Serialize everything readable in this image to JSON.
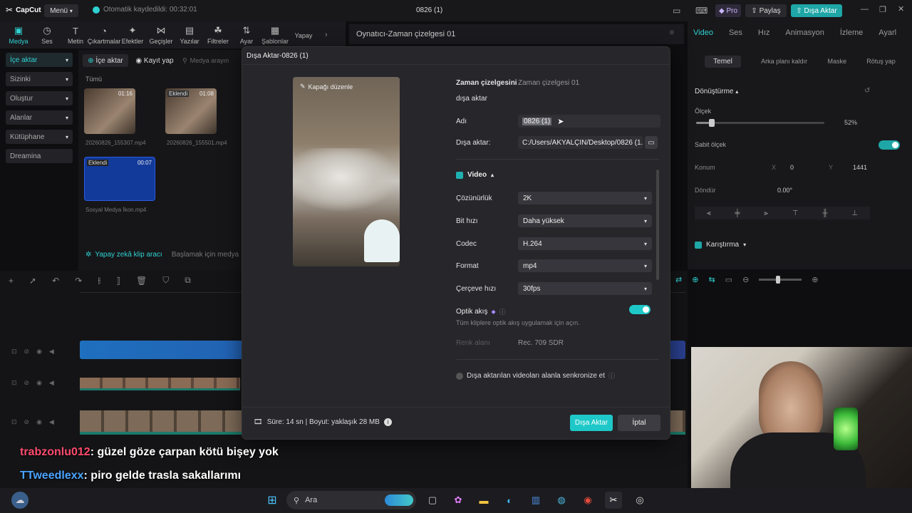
{
  "titlebar": {
    "app": "CapCut",
    "menu": "Menü",
    "autosave": "Otomatik kaydedildi: 00:32:01",
    "project": "0826 (1)",
    "pro": "Pro",
    "share": "Paylaş",
    "export": "Dışa Aktar"
  },
  "toolbar": {
    "items": [
      "Medya",
      "Ses",
      "Metin",
      "Çıkartmalar",
      "Efektler",
      "Geçişler",
      "Yazılar",
      "Filtreler",
      "Ayar",
      "Şablonlar",
      "Yapay"
    ]
  },
  "sidebar": {
    "items": [
      "İçe aktar",
      "Sizinki",
      "Oluştur",
      "Alanlar",
      "Kütüphane",
      "Dreamina"
    ]
  },
  "media": {
    "import": "İçe aktar",
    "record": "Kayıt yap",
    "search_placeholder": "Medya arayın",
    "all": "Tümü",
    "clips": [
      {
        "name": "20260826_155307.mp4",
        "dur": "01:16",
        "badge": ""
      },
      {
        "name": "20260826_155501.mp4",
        "dur": "01:08",
        "badge": "Eklendi"
      },
      {
        "name": "Sosyal Medya İkon.mp4",
        "dur": "00:07",
        "badge": "Eklendi"
      }
    ],
    "ai_clip": "Yapay zekâ klip aracı",
    "ai_hint": "Başlamak için medya"
  },
  "player": {
    "title": "Oynatıcı-Zaman çizelgesi 01"
  },
  "right": {
    "tabs": [
      "Video",
      "Ses",
      "Hız",
      "Animasyon",
      "İzleme",
      "Ayarl"
    ],
    "subtabs": [
      "Temel",
      "Arka planı kaldır",
      "Maske",
      "Rötuş yap"
    ],
    "transform": "Dönüştürme",
    "scale": "Ölçek",
    "scale_val": "52%",
    "scale_level": 0.12,
    "uniform": "Sabit ölçek",
    "position": "Konum",
    "x_label": "X",
    "x_val": "0",
    "y_label": "Y",
    "y_val": "1441",
    "rotate": "Döndür",
    "rotate_val": "0.00°",
    "blend": "Karıştırma"
  },
  "dialog": {
    "title": "Dışa Aktar-0826 (1)",
    "edit_cover": "Kapağı düzenle",
    "timeline_label": "Zaman çizelgesini",
    "timeline_label2": "dışa aktar",
    "timeline_val": "Zaman çizelgesi 01",
    "name_label": "Adı",
    "name_val": "0826 (1)",
    "path_label": "Dışa aktar:",
    "path_val": "C:/Users/AKYALÇIN/Desktop/0826 (1...",
    "video_section": "Video",
    "resolution_label": "Çözünürlük",
    "resolution_val": "2K",
    "bitrate_label": "Bit hızı",
    "bitrate_val": "Daha yüksek",
    "codec_label": "Codec",
    "codec_val": "H.264",
    "format_label": "Format",
    "format_val": "mp4",
    "fps_label": "Çerçeve hızı",
    "fps_val": "30fps",
    "optical_label": "Optik akış",
    "optical_hint": "Tüm kliplere optik akış uygulamak için açın.",
    "color_label": "Renk alanı",
    "color_val": "Rec. 709 SDR",
    "sync_label": "Dışa aktarılan videoları alanla senkronize et",
    "footer_info": "Süre: 14 sn | Boyut: yaklaşık 28 MB",
    "export_btn": "Dışa Aktar",
    "cancel_btn": "İptal"
  },
  "chat": [
    {
      "user": "trabzonlu012",
      "msg": ": güzel göze çarpan kötü bişey yok",
      "color": "#ff4b6e"
    },
    {
      "user": "TTweedlexx",
      "msg": ": piro gelde trasla sakallarımı",
      "color": "#4aa3ff"
    }
  ],
  "taskbar": {
    "search": "Ara"
  },
  "colors": {
    "accent": "#2fd1d1",
    "dialog_bg": "#26262b"
  }
}
